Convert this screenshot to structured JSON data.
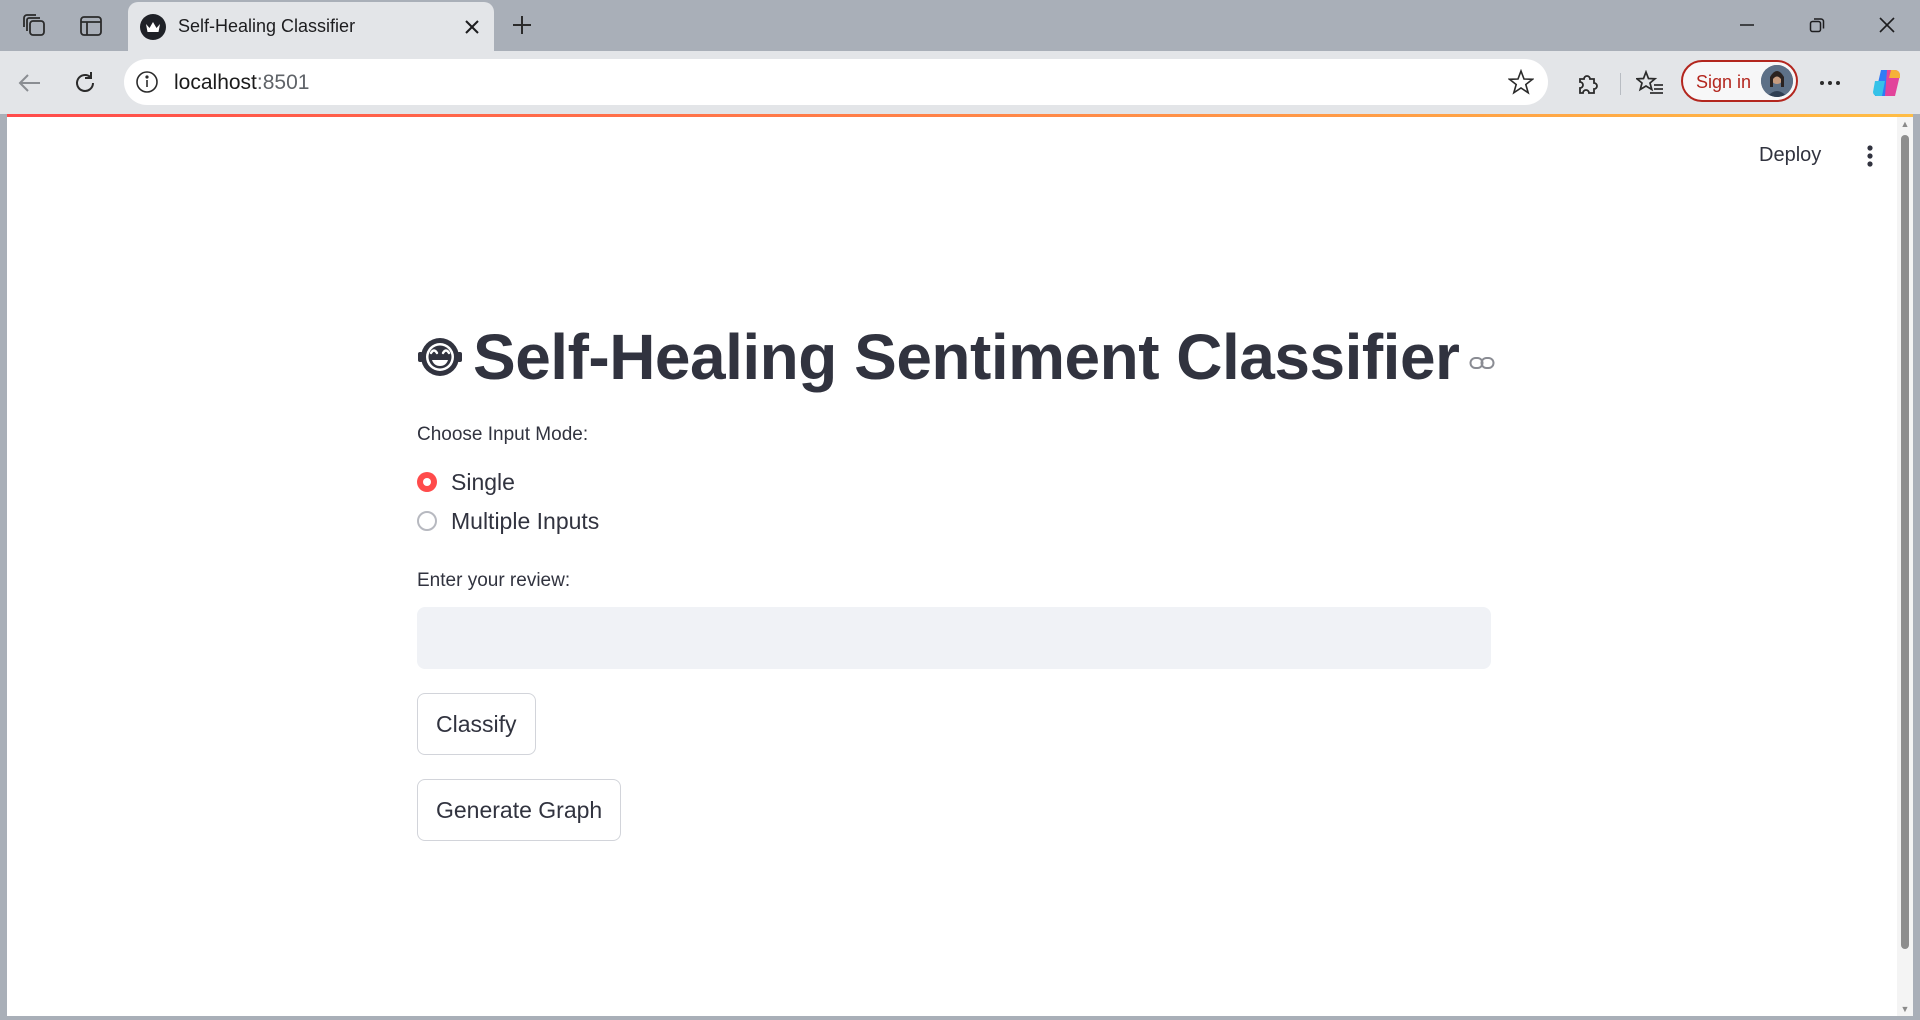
{
  "browser": {
    "tab": {
      "title": "Self-Healing Classifier",
      "favicon": "crown-favicon-icon"
    },
    "address_bar": {
      "host": "localhost",
      "port": ":8501"
    },
    "signin": {
      "label": "Sign in"
    },
    "icons": {
      "workspaces": "workspaces-icon",
      "tab_actions": "tab-actions-icon",
      "new_tab": "plus-icon",
      "back": "back-arrow-icon",
      "refresh": "refresh-icon",
      "site_info": "info-icon",
      "favorite": "star-icon",
      "extensions": "puzzle-icon",
      "favorites": "favorites-list-icon",
      "more": "more-horizontal-icon",
      "copilot": "copilot-icon"
    }
  },
  "app": {
    "header": {
      "deploy_label": "Deploy",
      "menu_icon": "more-vertical-icon"
    },
    "title": "Self-Healing Sentiment Classifier",
    "title_emoji": "robot-face-icon",
    "input_mode": {
      "label": "Choose Input Mode:",
      "options": [
        "Single",
        "Multiple Inputs"
      ],
      "selected": "Single"
    },
    "review": {
      "label": "Enter your review:",
      "value": "",
      "placeholder": ""
    },
    "buttons": {
      "classify": "Classify",
      "generate_graph": "Generate Graph"
    }
  },
  "colors": {
    "primary": "#ff4b4b",
    "text": "#31333f",
    "input_bg": "#f0f2f6",
    "signin_accent": "#b3261e",
    "chrome_bg": "#a9afb8"
  }
}
